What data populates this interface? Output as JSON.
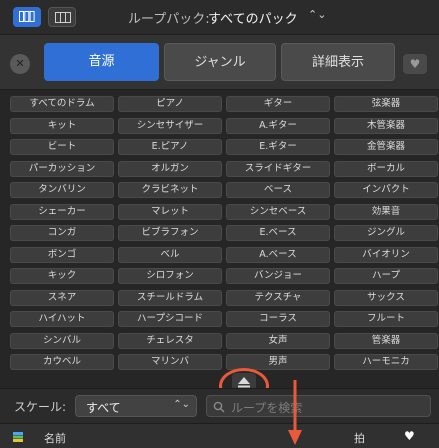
{
  "toolbar": {
    "loop_pack_label": "ループパック:",
    "loop_pack_value": "すべてのパック",
    "view_buttons": [
      "grid-view-icon",
      "column-view-icon"
    ]
  },
  "tabs": [
    {
      "label": "音源",
      "active": true
    },
    {
      "label": "ジャンル",
      "active": false
    },
    {
      "label": "詳細表示",
      "active": false
    }
  ],
  "keywords": [
    "すべてのドラム",
    "ピアノ",
    "ギター",
    "弦楽器",
    "キット",
    "シンセサイザー",
    "A.ギター",
    "木管楽器",
    "ビート",
    "E.ピアノ",
    "E.ギター",
    "金管楽器",
    "パーカッション",
    "オルガン",
    "スライドギター",
    "ボーカル",
    "タンバリン",
    "クラビネット",
    "ベース",
    "インパクト",
    "シェーカー",
    "マレット",
    "シンセベース",
    "効果音",
    "コンガ",
    "ビブラフォン",
    "E.ベース",
    "ジングル",
    "ボンゴ",
    "ベル",
    "A.ベース",
    "バイオリン",
    "キック",
    "シロフォン",
    "バンジョー",
    "ハープ",
    "スネア",
    "スチールドラム",
    "テクスチャ",
    "サックス",
    "ハイハット",
    "ハープシコード",
    "コーラス",
    "フルート",
    "シンバル",
    "チェレスタ",
    "女声",
    "管楽器",
    "カウベル",
    "マリンバ",
    "男声",
    "ハーモニカ"
  ],
  "scale": {
    "label": "スケール:",
    "value": "すべて"
  },
  "search": {
    "placeholder": "ループを検索"
  },
  "columns": {
    "name": "名前",
    "beat": "拍"
  },
  "colors": {
    "accent": "#2f6fd6",
    "annotation": "#ea5a3a"
  }
}
